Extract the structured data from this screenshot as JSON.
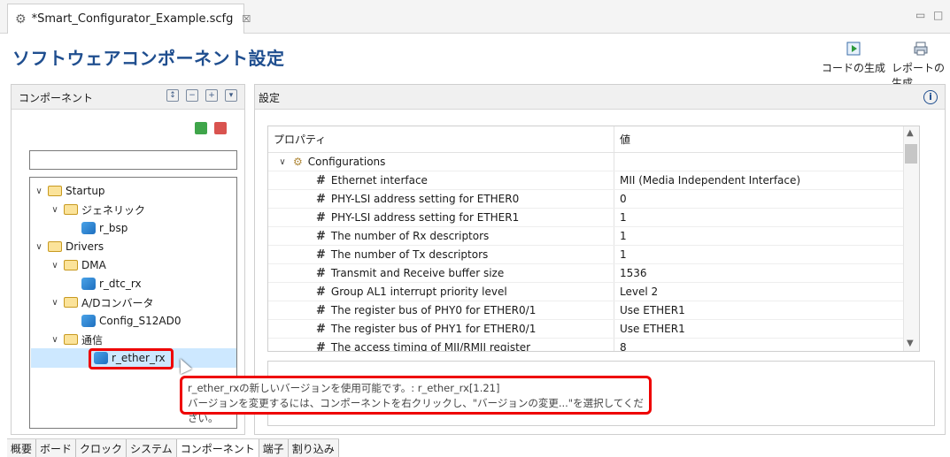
{
  "editor_tab": {
    "title": "*Smart_Configurator_Example.scfg",
    "close_glyph": "☒"
  },
  "window_controls": {
    "minimize": "▭",
    "maximize": "□"
  },
  "header": {
    "title": "ソフトウェアコンポーネント設定",
    "generate_code": "コードの生成",
    "generate_report": "レポートの生成"
  },
  "left_panel": {
    "title": "コンポーネント",
    "tree": [
      {
        "label": "Startup",
        "icon": "folder-icon",
        "chev": "∨"
      },
      {
        "label": "ジェネリック",
        "icon": "folder-icon",
        "chev": "∨"
      },
      {
        "label": "r_bsp",
        "icon": "component-icon"
      },
      {
        "label": "Drivers",
        "icon": "folder-icon",
        "chev": "∨"
      },
      {
        "label": "DMA",
        "icon": "folder-icon",
        "chev": "∨"
      },
      {
        "label": "r_dtc_rx",
        "icon": "component-update-icon"
      },
      {
        "label": "A/Dコンバータ",
        "icon": "folder-icon",
        "chev": "∨"
      },
      {
        "label": "Config_S12AD0",
        "icon": "component-icon"
      },
      {
        "label": "通信",
        "icon": "folder-icon",
        "chev": "∨"
      },
      {
        "label": "r_ether_rx",
        "icon": "component-update-icon"
      }
    ]
  },
  "right_panel": {
    "title": "設定",
    "columns": {
      "property": "プロパティ",
      "value": "値"
    },
    "group": "Configurations",
    "rows": [
      {
        "name": "Ethernet interface",
        "value": "MII  (Media Independent Interface)"
      },
      {
        "name": "PHY-LSI address setting for ETHER0",
        "value": "0"
      },
      {
        "name": "PHY-LSI address setting for ETHER1",
        "value": "1"
      },
      {
        "name": "The number of Rx descriptors",
        "value": "1"
      },
      {
        "name": "The number of Tx descriptors",
        "value": "1"
      },
      {
        "name": "Transmit and Receive buffer size",
        "value": "1536"
      },
      {
        "name": "Group AL1 interrupt priority level",
        "value": "Level 2"
      },
      {
        "name": "The register bus of PHY0 for ETHER0/1",
        "value": "Use ETHER1"
      },
      {
        "name": "The register bus of PHY1 for ETHER0/1",
        "value": "Use ETHER1"
      },
      {
        "name": "The access timing of MII/RMII register",
        "value": "8"
      }
    ]
  },
  "tooltip": {
    "line1": "r_ether_rxの新しいバージョンを使用可能です。: r_ether_rx[1.21]",
    "line2": "バージョンを変更するには、コンポーネントを右クリックし、\"バージョンの変更...\"を選択してください。"
  },
  "bottom_tabs": [
    "概要",
    "ボード",
    "クロック",
    "システム",
    "コンポーネント",
    "端子",
    "割り込み"
  ],
  "colors": {
    "accent": "#1f4e8f",
    "highlight": "#e00000",
    "selection": "#cde8ff"
  }
}
